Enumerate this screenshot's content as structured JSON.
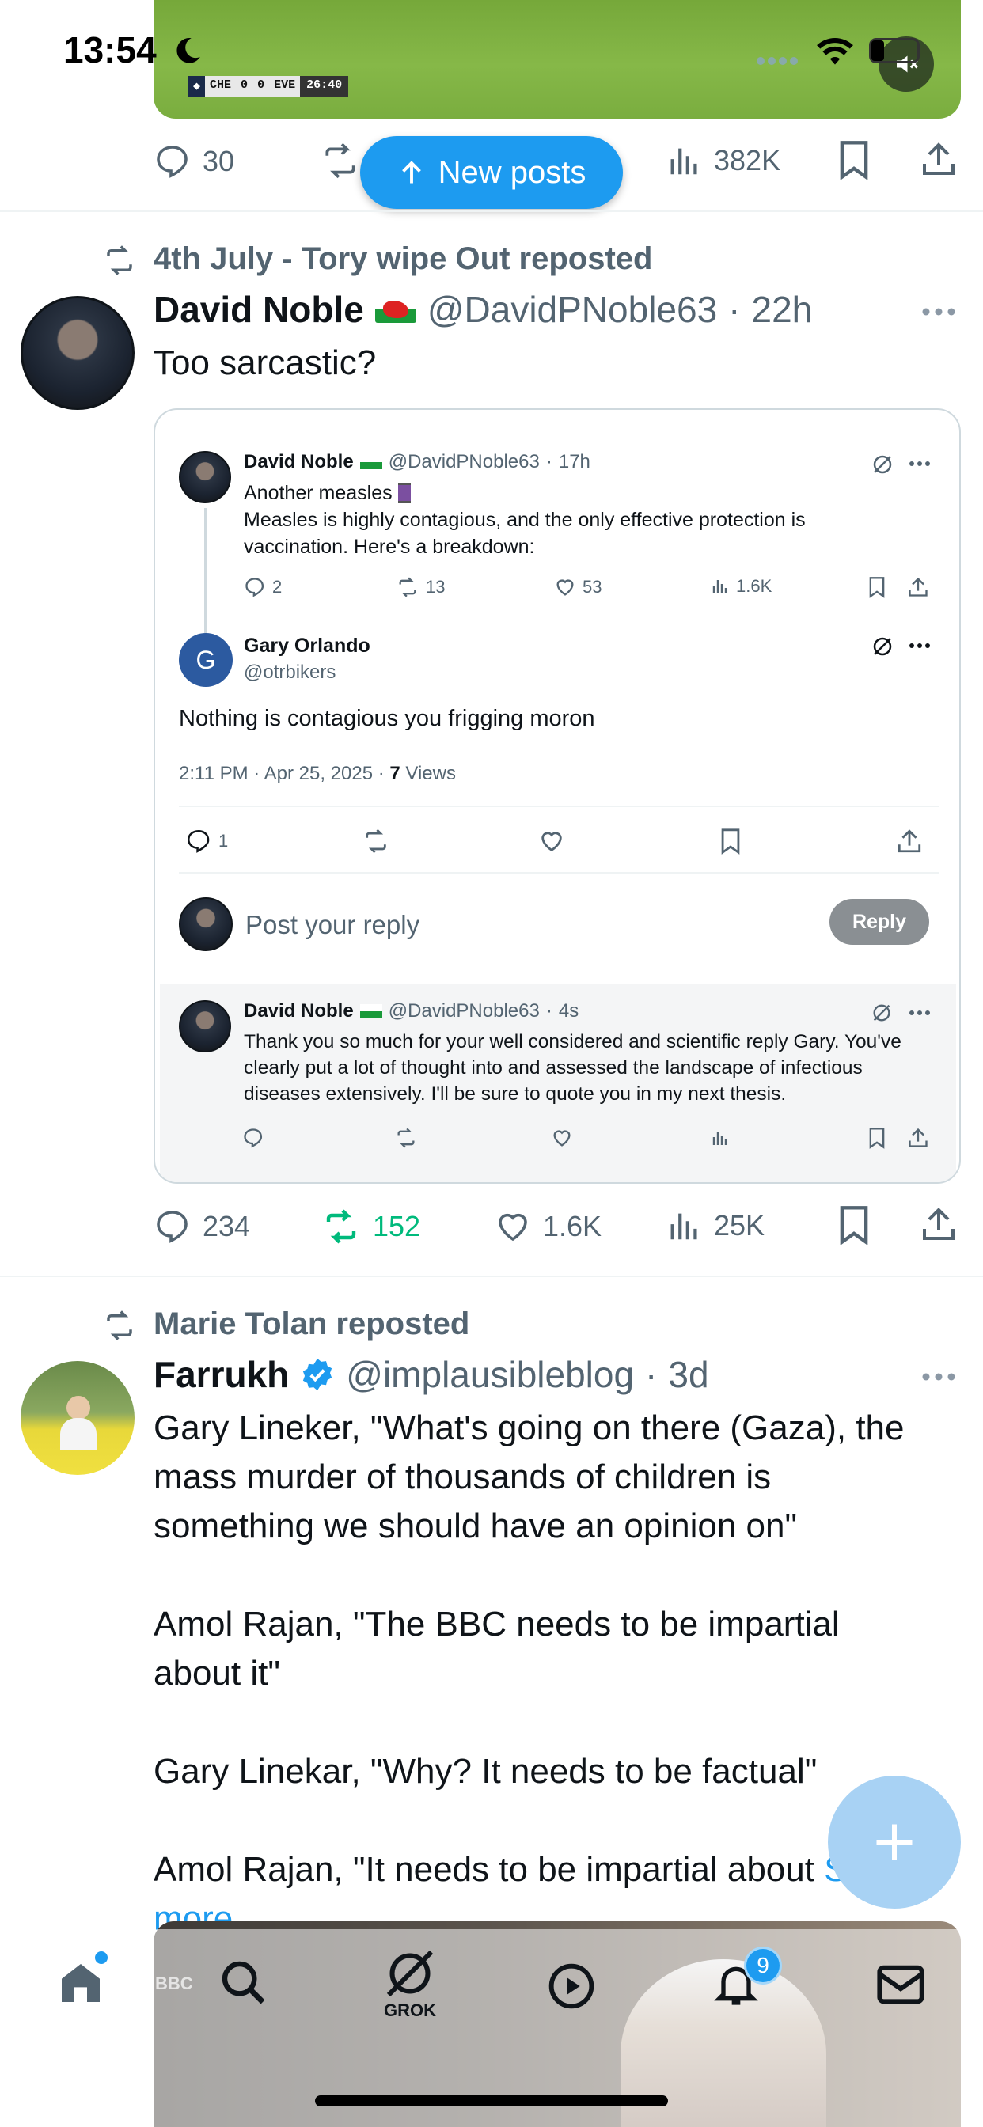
{
  "status_bar": {
    "time": "13:54"
  },
  "video_thumb": {
    "score_home": "CHE",
    "score_home_val": "0",
    "score_away_val": "0",
    "score_away": "EVE",
    "clock": "26:40"
  },
  "top_actions": {
    "replies": "30",
    "views": "382K"
  },
  "new_posts": {
    "label": "New posts"
  },
  "tweet1": {
    "repost_label": "4th July - Tory wipe Out reposted",
    "name": "David Noble",
    "handle": "@DavidPNoble63",
    "time": "22h",
    "text": "Too sarcastic?",
    "actions": {
      "replies": "234",
      "reposts": "152",
      "likes": "1.6K",
      "views": "25K"
    },
    "quoted": {
      "post1": {
        "name": "David Noble",
        "handle": "@DavidPNoble63",
        "time": "17h",
        "line1": "Another measles",
        "body": "Measles is highly contagious, and the only effective protection is vaccination. Here's a breakdown:",
        "replies": "2",
        "reposts": "13",
        "likes": "53",
        "views": "1.6K"
      },
      "post2": {
        "name": "Gary Orlando",
        "handle": "@otrbikers",
        "avatar_letter": "G",
        "text": "Nothing is contagious you frigging moron",
        "meta_time": "2:11 PM · Apr 25, 2025 · ",
        "meta_views_count": "7",
        "meta_views_label": " Views",
        "replies": "1"
      },
      "reply_box": {
        "placeholder": "Post your reply",
        "button": "Reply"
      },
      "post3": {
        "name": "David Noble",
        "handle": "@DavidPNoble63",
        "time": "4s",
        "text": "Thank you so much for your well considered and scientific reply Gary. You've clearly put a lot of thought into and assessed the landscape of infectious diseases extensively. I'll be sure to quote you in my next thesis."
      }
    }
  },
  "tweet2": {
    "repost_label": "Marie Tolan reposted",
    "name": "Farrukh",
    "handle": "@implausibleblog",
    "time": "3d",
    "para1": "Gary Lineker, \"What's going on there (Gaza), the mass murder of thousands of children is something we should have an opinion on\"",
    "para2": "Amol Rajan, \"The BBC needs to be impartial about it\"",
    "para3": "Gary Linekar, \"Why? It needs to be factual\"",
    "para4_start": "Amol Rajan, \"It needs to be impartial about ",
    "show_more": "Show more"
  },
  "bottom_nav": {
    "grok_label": "GROK",
    "notification_count": "9",
    "bbc_label": "BBC"
  },
  "colors": {
    "accent": "#1d9bf0",
    "repost_green": "#00ba7c",
    "text_gray": "#536471",
    "border": "#eff3f4"
  }
}
